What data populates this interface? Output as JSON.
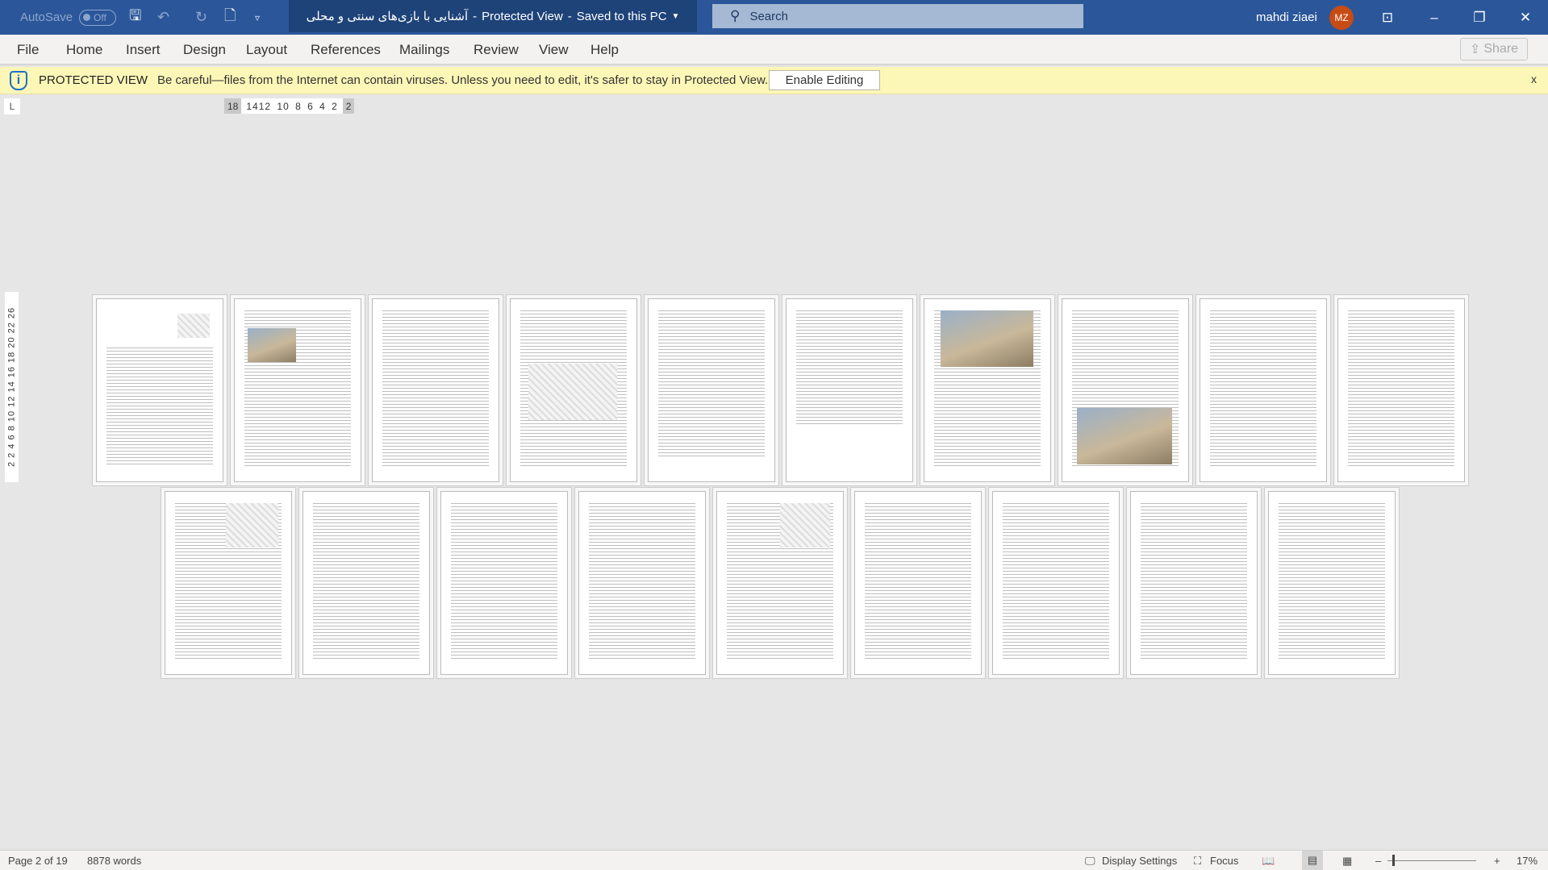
{
  "titlebar": {
    "autosave_label": "AutoSave",
    "autosave_state": "Off",
    "document_title": "آشنایی با بازی‌های سنتی و محلی",
    "separator1": "-",
    "view_mode": "Protected View",
    "separator2": "-",
    "save_status": "Saved to this PC",
    "search_placeholder": "Search",
    "user_name": "mahdi ziaei",
    "user_initials": "MZ"
  },
  "ribbon": {
    "tabs": [
      "File",
      "Home",
      "Insert",
      "Design",
      "Layout",
      "References",
      "Mailings",
      "Review",
      "View",
      "Help"
    ],
    "share_label": "Share"
  },
  "protected_view": {
    "title": "PROTECTED VIEW",
    "message": "Be careful—files from the Internet can contain viruses. Unless you need to edit, it's safer to stay in Protected View.",
    "button": "Enable Editing",
    "close": "x"
  },
  "ruler": {
    "left": "18",
    "middle": "1412 10 8 6 4 2",
    "right": "2",
    "vertical": "2 2 4 6 8 10 12 14 16 18 20 22 26",
    "corner": "L"
  },
  "pages": {
    "count": 19,
    "with_images": [
      1,
      2,
      4,
      7,
      8,
      11,
      15
    ]
  },
  "status": {
    "page": "Page 2 of 19",
    "words": "8878 words",
    "display_settings": "Display Settings",
    "focus": "Focus",
    "zoom": "17%"
  },
  "colors": {
    "titlebar": "#2b579a",
    "protected_bar": "#fdf7b7",
    "avatar": "#c74b14"
  }
}
